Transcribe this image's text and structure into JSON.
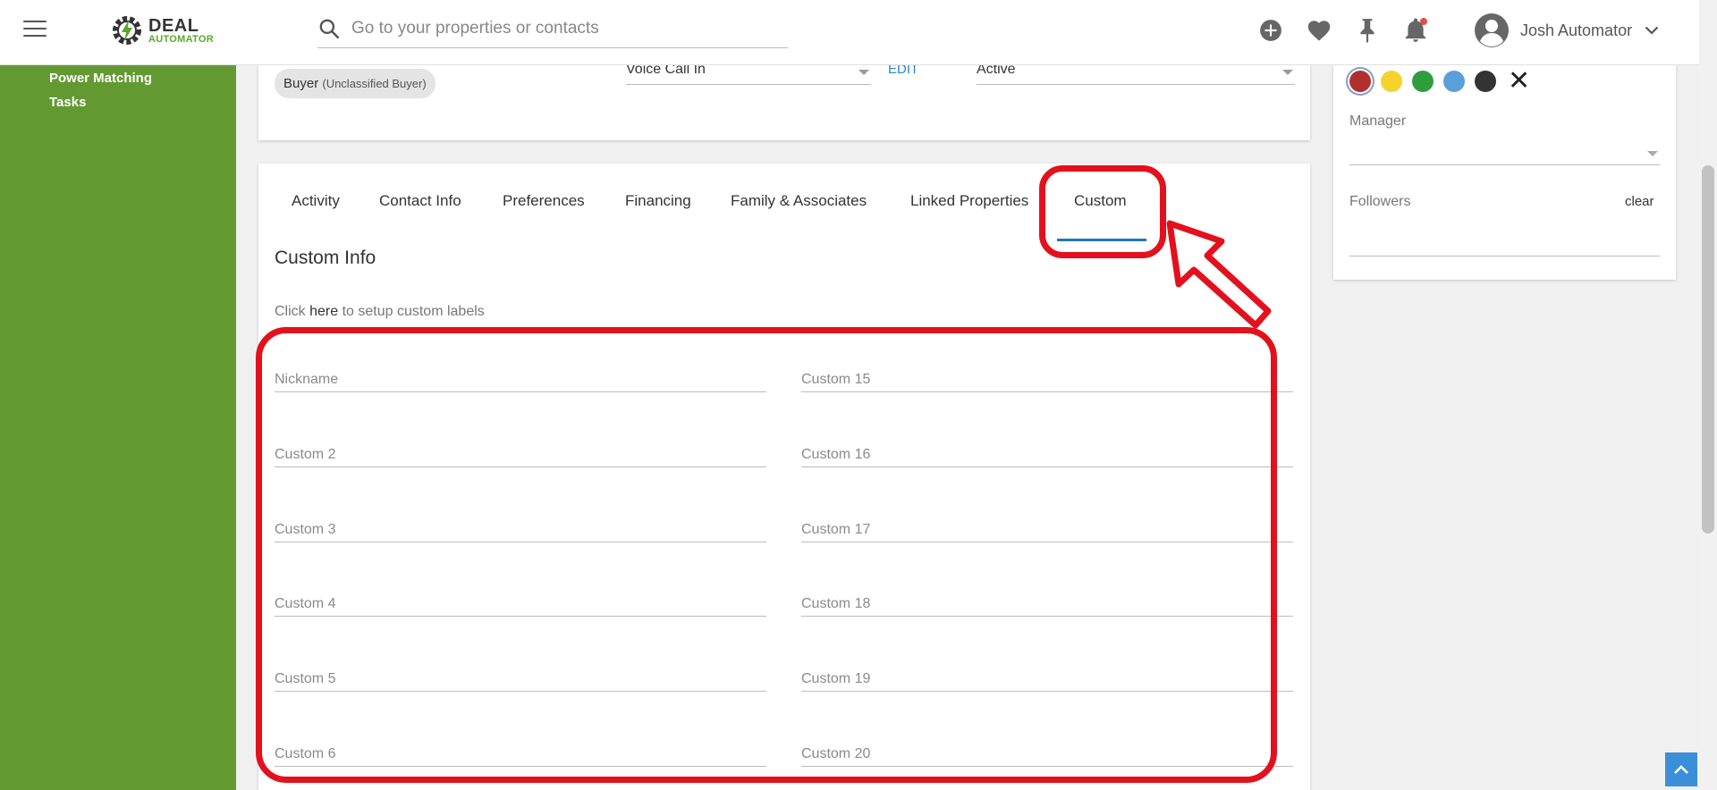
{
  "header": {
    "logo_top": "DEAL",
    "logo_bottom": "AUTOMATOR",
    "search_placeholder": "Go to your properties or contacts",
    "user_name": "Josh Automator"
  },
  "sidebar": {
    "items": [
      {
        "label": "Power Matching"
      },
      {
        "label": "Tasks"
      }
    ]
  },
  "contact_card": {
    "chip_label": "Buyer",
    "chip_sub": "(Unclassified Buyer)",
    "source_value": "Voice Call In",
    "edit_label": "EDIT",
    "status_value": "Active"
  },
  "tabs": [
    {
      "label": "Activity"
    },
    {
      "label": "Contact Info"
    },
    {
      "label": "Preferences"
    },
    {
      "label": "Financing"
    },
    {
      "label": "Family & Associates"
    },
    {
      "label": "Linked Properties"
    },
    {
      "label": "Custom",
      "active": true
    }
  ],
  "custom": {
    "title": "Custom Info",
    "setup_prefix": "Click ",
    "setup_link": "here",
    "setup_suffix": " to setup custom labels",
    "left_fields": [
      "Nickname",
      "Custom 2",
      "Custom 3",
      "Custom 4",
      "Custom 5",
      "Custom 6"
    ],
    "right_fields": [
      "Custom 15",
      "Custom 16",
      "Custom 17",
      "Custom 18",
      "Custom 19",
      "Custom 20"
    ]
  },
  "right_panel": {
    "colors": [
      "#b0302e",
      "#f7d22e",
      "#2e9e3c",
      "#5b9fd9",
      "#333333"
    ],
    "close_symbol": "✕",
    "manager_label": "Manager",
    "followers_label": "Followers",
    "clear_label": "clear"
  },
  "theme": {
    "sidebar_green": "#629a31",
    "accent_blue": "#1f77c0",
    "annotation_red": "#e3111d"
  }
}
